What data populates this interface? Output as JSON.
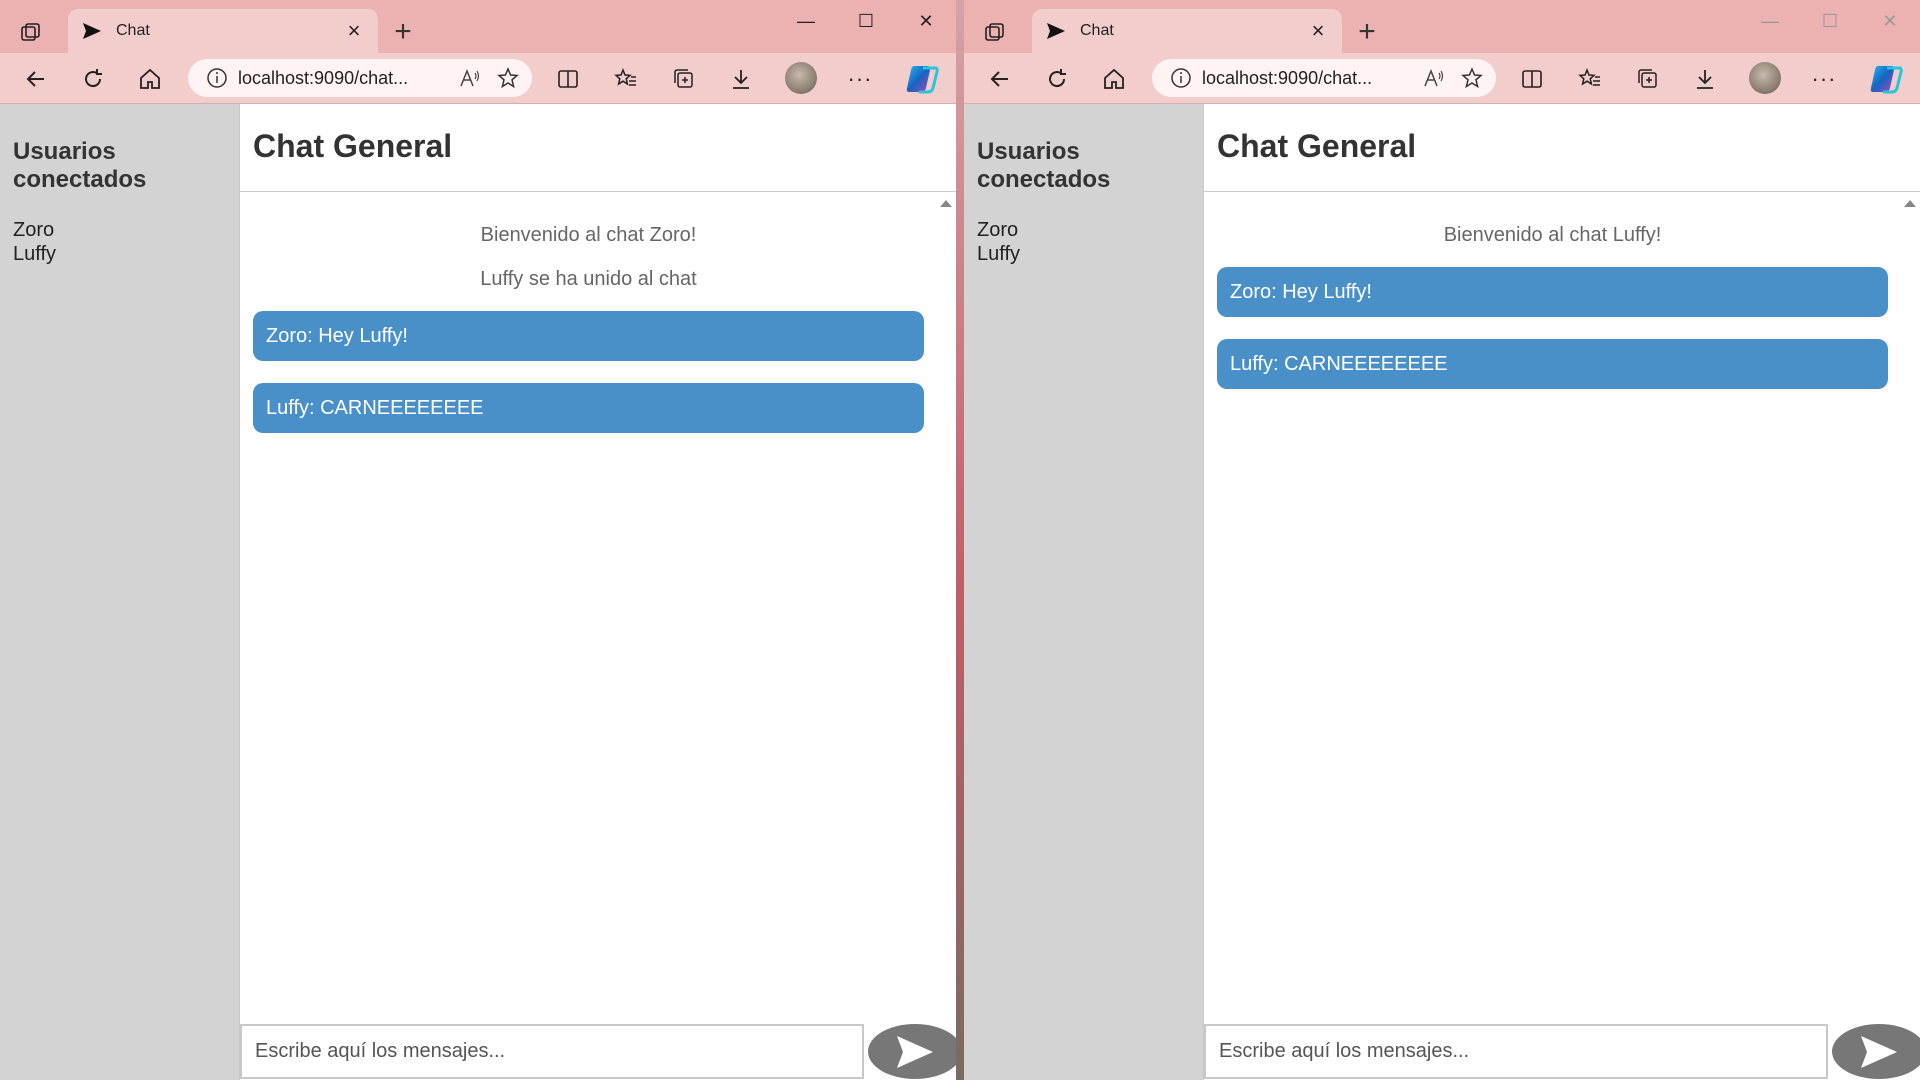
{
  "windows": [
    {
      "tab": {
        "title": "Chat"
      },
      "address": {
        "url": "localhost:9090/chat..."
      },
      "sidebar": {
        "heading": "Usuarios conectados",
        "users": [
          "Zoro",
          "Luffy"
        ]
      },
      "chat": {
        "title": "Chat General",
        "system_messages": [
          "Bienvenido al chat Zoro!",
          "Luffy se ha unido al chat"
        ],
        "messages": [
          "Zoro: Hey Luffy!",
          "Luffy: CARNEEEEEEEE"
        ]
      },
      "composer": {
        "placeholder": "Escribe aquí los mensajes..."
      }
    },
    {
      "tab": {
        "title": "Chat"
      },
      "address": {
        "url": "localhost:9090/chat..."
      },
      "sidebar": {
        "heading": "Usuarios conectados",
        "users": [
          "Zoro",
          "Luffy"
        ]
      },
      "chat": {
        "title": "Chat General",
        "system_messages": [
          "Bienvenido al chat Luffy!"
        ],
        "messages": [
          "Zoro: Hey Luffy!",
          "Luffy: CARNEEEEEEEE"
        ]
      },
      "composer": {
        "placeholder": "Escribe aquí los mensajes..."
      }
    }
  ],
  "colors": {
    "tabstrip": "#ecb1b1",
    "toolbar": "#f3cccc",
    "sidebar": "#d3d3d3",
    "bubble": "#4a90c8",
    "send_button": "#777777"
  },
  "icons": [
    "workspaces-icon",
    "send-favicon-icon",
    "close-tab-icon",
    "new-tab-icon",
    "minimize-icon",
    "maximize-icon",
    "close-window-icon",
    "back-icon",
    "refresh-icon",
    "home-icon",
    "info-icon",
    "read-aloud-icon",
    "favorite-star-icon",
    "split-screen-icon",
    "favorites-icon",
    "collections-icon",
    "downloads-icon",
    "more-icon",
    "copilot-icon",
    "send-arrow-icon"
  ]
}
